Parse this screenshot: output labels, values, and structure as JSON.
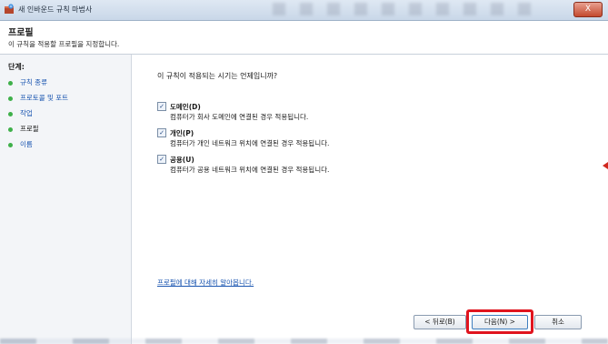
{
  "window": {
    "title": "새 인바운드 규칙 마법사",
    "close_label": "X"
  },
  "header": {
    "title": "프로필",
    "subtitle": "이 규칙을 적용할 프로필을 지정합니다."
  },
  "steps": {
    "title": "단계:",
    "items": [
      {
        "label": "규칙 종류",
        "current": false
      },
      {
        "label": "프로토콜 및 포트",
        "current": false
      },
      {
        "label": "작업",
        "current": false
      },
      {
        "label": "프로필",
        "current": true
      },
      {
        "label": "이름",
        "current": false
      }
    ]
  },
  "main": {
    "question": "이 규칙이 적용되는 시기는 언제입니까?",
    "options": [
      {
        "label": "도메인(D)",
        "checked": true,
        "description": "컴퓨터가 회사 도메인에 연결된 경우 적용됩니다."
      },
      {
        "label": "개인(P)",
        "checked": true,
        "description": "컴퓨터가 개인 네트워크 위치에 연결된 경우 적용됩니다."
      },
      {
        "label": "공용(U)",
        "checked": true,
        "description": "컴퓨터가 공용 네트워크 위치에 연결된 경우 적용됩니다."
      }
    ],
    "help_link": "프로필에 대해 자세히 알아봅니다."
  },
  "buttons": {
    "back": "< 뒤로(B)",
    "next": "다음(N) >",
    "cancel": "취소"
  },
  "colors": {
    "highlight": "#e0141e",
    "step_dot": "#3fb04a",
    "link": "#1a55b0"
  },
  "icons": {
    "window": "firewall-wizard-icon",
    "checkbox_checked": "check-icon"
  }
}
